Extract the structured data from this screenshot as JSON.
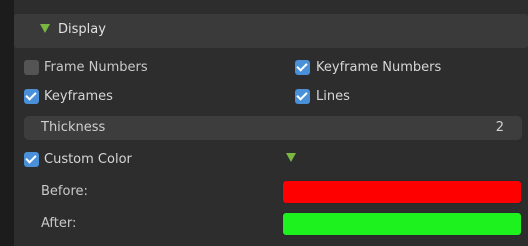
{
  "header": {
    "title": "Display",
    "expanded": true
  },
  "options": {
    "frame_numbers": {
      "label": "Frame Numbers",
      "checked": false
    },
    "keyframe_numbers": {
      "label": "Keyframe Numbers",
      "checked": true
    },
    "keyframes": {
      "label": "Keyframes",
      "checked": true
    },
    "lines": {
      "label": "Lines",
      "checked": true
    }
  },
  "thickness": {
    "label": "Thickness",
    "value": "2"
  },
  "custom_color": {
    "label": "Custom Color",
    "checked": true
  },
  "before": {
    "label": "Before:",
    "color": "#ff0000"
  },
  "after": {
    "label": "After:",
    "color": "#1ef21e"
  },
  "colors": {
    "accent": "#4a90d9",
    "triangle": "#79b843"
  }
}
